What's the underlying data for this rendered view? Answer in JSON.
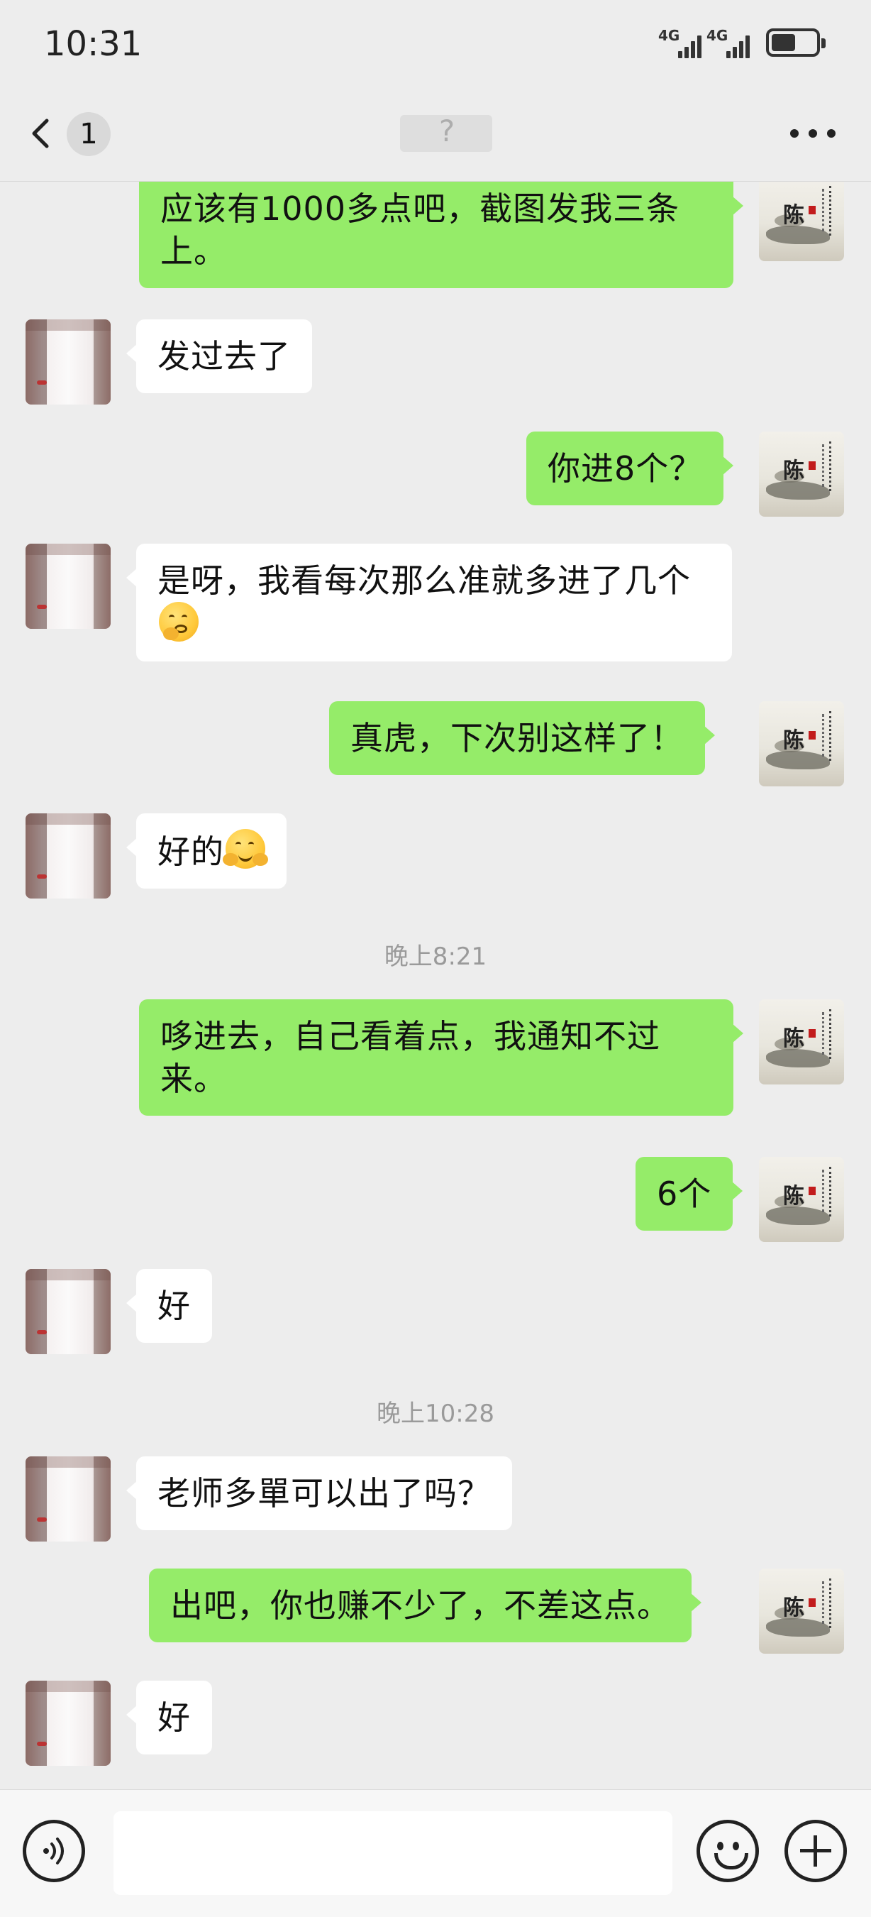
{
  "status_bar": {
    "time": "10:31",
    "signal1": "4G",
    "signal2": "4G",
    "battery_level": 0.55
  },
  "nav": {
    "unread_count": "1",
    "title": "?"
  },
  "messages": [
    {
      "from": "me",
      "text": "应该有1000多点吧，截图发我三条上。"
    },
    {
      "from": "them",
      "text": "发过去了"
    },
    {
      "from": "me",
      "text": "你进8个？"
    },
    {
      "from": "them",
      "text": "是呀，我看每次那么准就多进了几个",
      "emoji": "thinking-face-emoji"
    },
    {
      "from": "me",
      "text": "真虎，下次别这样了！"
    },
    {
      "from": "them",
      "text": "好的",
      "emoji": "hugging-face-emoji"
    },
    {
      "type": "timestamp",
      "text": "晚上8:21"
    },
    {
      "from": "me",
      "text": "哆进去，自己看着点，我通知不过来。"
    },
    {
      "from": "me",
      "text": "6个"
    },
    {
      "from": "them",
      "text": "好"
    },
    {
      "type": "timestamp",
      "text": "晚上10:28"
    },
    {
      "from": "them",
      "text": "老师多單可以出了吗？"
    },
    {
      "from": "me",
      "text": "出吧，你也赚不少了，不差这点。"
    },
    {
      "from": "them",
      "text": "好"
    }
  ],
  "input_bar": {
    "placeholder": "",
    "icons": [
      "voice-icon",
      "emoji-icon",
      "plus-icon"
    ]
  },
  "colors": {
    "my_bubble": "#95ec69",
    "their_bubble": "#ffffff",
    "background": "#ededed"
  }
}
